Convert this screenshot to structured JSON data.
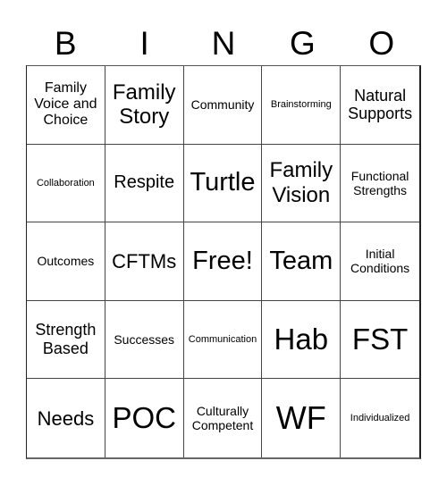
{
  "header": {
    "letters": [
      "B",
      "I",
      "N",
      "G",
      "O"
    ]
  },
  "cells": [
    "Family Voice and Choice",
    "Family Story",
    "Community",
    "Brainstorming",
    "Natural Supports",
    "Collaboration",
    "Respite",
    "Turtle",
    "Family Vision",
    "Functional Strengths",
    "Outcomes",
    "CFTMs",
    "Free!",
    "Team",
    "Initial Conditions",
    "Strength Based",
    "Successes",
    "Communication",
    "Hab",
    "FST",
    "Needs",
    "POC",
    "Culturally Competent",
    "WF",
    "Individualized"
  ]
}
